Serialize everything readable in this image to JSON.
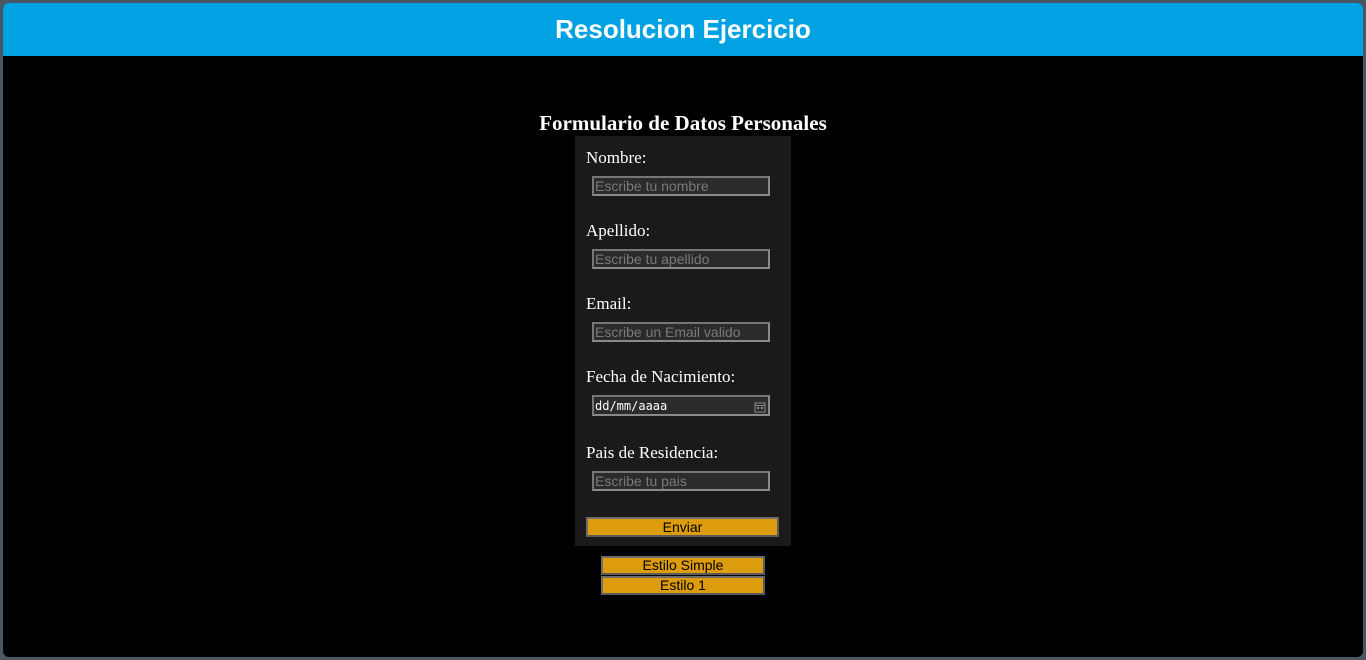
{
  "header": {
    "title": "Resolucion Ejercicio"
  },
  "form": {
    "title": "Formulario de Datos Personales",
    "fields": [
      {
        "label": "Nombre:",
        "placeholder": "Escribe tu nombre"
      },
      {
        "label": "Apellido:",
        "placeholder": "Escribe tu apellido"
      },
      {
        "label": "Email:",
        "placeholder": "Escribe un Email valido"
      },
      {
        "label": "Fecha de Nacimiento:",
        "value": "dd/mm/aaaa"
      },
      {
        "label": "Pais de Residencia:",
        "placeholder": "Escribe tu pais"
      }
    ],
    "submit_label": "Enviar"
  },
  "style_buttons": {
    "simple_label": "Estilo Simple",
    "style1_label": "Estilo 1"
  },
  "colors": {
    "header_bg": "#00a2e4",
    "page_bg": "#000000",
    "form_bg": "#1b1919",
    "button_bg": "#dc9c0e"
  },
  "icons": {
    "date_picker": "calendar-icon"
  }
}
